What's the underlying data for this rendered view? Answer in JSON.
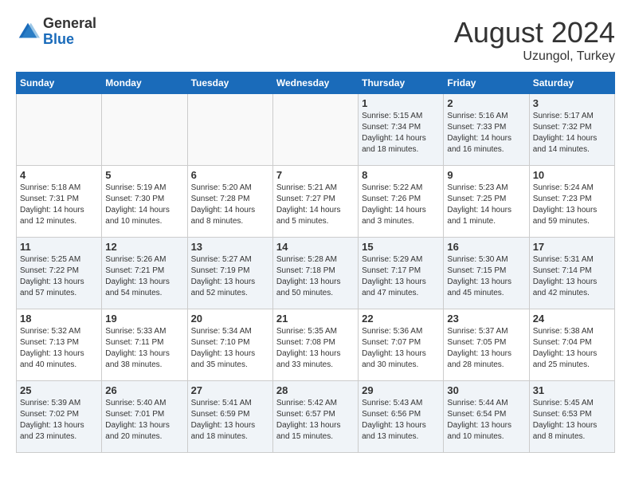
{
  "header": {
    "logo_general": "General",
    "logo_blue": "Blue",
    "month_year": "August 2024",
    "location": "Uzungol, Turkey"
  },
  "days_of_week": [
    "Sunday",
    "Monday",
    "Tuesday",
    "Wednesday",
    "Thursday",
    "Friday",
    "Saturday"
  ],
  "weeks": [
    [
      {
        "day": "",
        "detail": ""
      },
      {
        "day": "",
        "detail": ""
      },
      {
        "day": "",
        "detail": ""
      },
      {
        "day": "",
        "detail": ""
      },
      {
        "day": "1",
        "detail": "Sunrise: 5:15 AM\nSunset: 7:34 PM\nDaylight: 14 hours\nand 18 minutes."
      },
      {
        "day": "2",
        "detail": "Sunrise: 5:16 AM\nSunset: 7:33 PM\nDaylight: 14 hours\nand 16 minutes."
      },
      {
        "day": "3",
        "detail": "Sunrise: 5:17 AM\nSunset: 7:32 PM\nDaylight: 14 hours\nand 14 minutes."
      }
    ],
    [
      {
        "day": "4",
        "detail": "Sunrise: 5:18 AM\nSunset: 7:31 PM\nDaylight: 14 hours\nand 12 minutes."
      },
      {
        "day": "5",
        "detail": "Sunrise: 5:19 AM\nSunset: 7:30 PM\nDaylight: 14 hours\nand 10 minutes."
      },
      {
        "day": "6",
        "detail": "Sunrise: 5:20 AM\nSunset: 7:28 PM\nDaylight: 14 hours\nand 8 minutes."
      },
      {
        "day": "7",
        "detail": "Sunrise: 5:21 AM\nSunset: 7:27 PM\nDaylight: 14 hours\nand 5 minutes."
      },
      {
        "day": "8",
        "detail": "Sunrise: 5:22 AM\nSunset: 7:26 PM\nDaylight: 14 hours\nand 3 minutes."
      },
      {
        "day": "9",
        "detail": "Sunrise: 5:23 AM\nSunset: 7:25 PM\nDaylight: 14 hours\nand 1 minute."
      },
      {
        "day": "10",
        "detail": "Sunrise: 5:24 AM\nSunset: 7:23 PM\nDaylight: 13 hours\nand 59 minutes."
      }
    ],
    [
      {
        "day": "11",
        "detail": "Sunrise: 5:25 AM\nSunset: 7:22 PM\nDaylight: 13 hours\nand 57 minutes."
      },
      {
        "day": "12",
        "detail": "Sunrise: 5:26 AM\nSunset: 7:21 PM\nDaylight: 13 hours\nand 54 minutes."
      },
      {
        "day": "13",
        "detail": "Sunrise: 5:27 AM\nSunset: 7:19 PM\nDaylight: 13 hours\nand 52 minutes."
      },
      {
        "day": "14",
        "detail": "Sunrise: 5:28 AM\nSunset: 7:18 PM\nDaylight: 13 hours\nand 50 minutes."
      },
      {
        "day": "15",
        "detail": "Sunrise: 5:29 AM\nSunset: 7:17 PM\nDaylight: 13 hours\nand 47 minutes."
      },
      {
        "day": "16",
        "detail": "Sunrise: 5:30 AM\nSunset: 7:15 PM\nDaylight: 13 hours\nand 45 minutes."
      },
      {
        "day": "17",
        "detail": "Sunrise: 5:31 AM\nSunset: 7:14 PM\nDaylight: 13 hours\nand 42 minutes."
      }
    ],
    [
      {
        "day": "18",
        "detail": "Sunrise: 5:32 AM\nSunset: 7:13 PM\nDaylight: 13 hours\nand 40 minutes."
      },
      {
        "day": "19",
        "detail": "Sunrise: 5:33 AM\nSunset: 7:11 PM\nDaylight: 13 hours\nand 38 minutes."
      },
      {
        "day": "20",
        "detail": "Sunrise: 5:34 AM\nSunset: 7:10 PM\nDaylight: 13 hours\nand 35 minutes."
      },
      {
        "day": "21",
        "detail": "Sunrise: 5:35 AM\nSunset: 7:08 PM\nDaylight: 13 hours\nand 33 minutes."
      },
      {
        "day": "22",
        "detail": "Sunrise: 5:36 AM\nSunset: 7:07 PM\nDaylight: 13 hours\nand 30 minutes."
      },
      {
        "day": "23",
        "detail": "Sunrise: 5:37 AM\nSunset: 7:05 PM\nDaylight: 13 hours\nand 28 minutes."
      },
      {
        "day": "24",
        "detail": "Sunrise: 5:38 AM\nSunset: 7:04 PM\nDaylight: 13 hours\nand 25 minutes."
      }
    ],
    [
      {
        "day": "25",
        "detail": "Sunrise: 5:39 AM\nSunset: 7:02 PM\nDaylight: 13 hours\nand 23 minutes."
      },
      {
        "day": "26",
        "detail": "Sunrise: 5:40 AM\nSunset: 7:01 PM\nDaylight: 13 hours\nand 20 minutes."
      },
      {
        "day": "27",
        "detail": "Sunrise: 5:41 AM\nSunset: 6:59 PM\nDaylight: 13 hours\nand 18 minutes."
      },
      {
        "day": "28",
        "detail": "Sunrise: 5:42 AM\nSunset: 6:57 PM\nDaylight: 13 hours\nand 15 minutes."
      },
      {
        "day": "29",
        "detail": "Sunrise: 5:43 AM\nSunset: 6:56 PM\nDaylight: 13 hours\nand 13 minutes."
      },
      {
        "day": "30",
        "detail": "Sunrise: 5:44 AM\nSunset: 6:54 PM\nDaylight: 13 hours\nand 10 minutes."
      },
      {
        "day": "31",
        "detail": "Sunrise: 5:45 AM\nSunset: 6:53 PM\nDaylight: 13 hours\nand 8 minutes."
      }
    ]
  ]
}
